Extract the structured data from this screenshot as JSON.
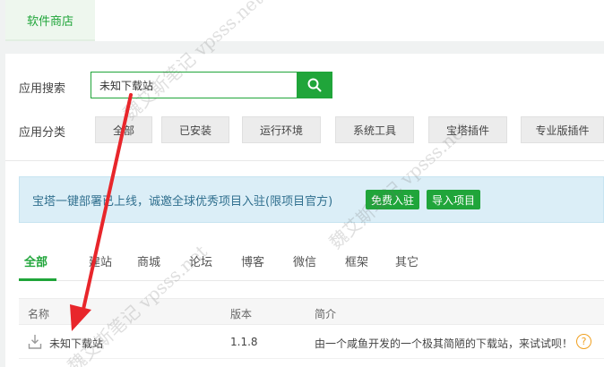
{
  "top_tab": {
    "label": "软件商店"
  },
  "search": {
    "label": "应用搜索",
    "value": "未知下载站"
  },
  "category": {
    "label": "应用分类",
    "buttons": [
      "全部",
      "已安装",
      "运行环境",
      "系统工具",
      "宝塔插件",
      "专业版插件"
    ]
  },
  "notice": {
    "text": "宝塔一键部署已上线，诚邀全球优秀项目入驻(限项目官方)",
    "btn_free": "免费入驻",
    "btn_import": "导入项目"
  },
  "tabs": [
    "全部",
    "建站",
    "商城",
    "论坛",
    "博客",
    "微信",
    "框架",
    "其它"
  ],
  "table": {
    "headers": [
      "名称",
      "版本",
      "简介"
    ],
    "rows": [
      {
        "name": "未知下载站",
        "version": "1.1.8",
        "desc": "由一个咸鱼开发的一个极其简陋的下载站，来试试呗！"
      }
    ]
  },
  "watermark": "魏艾斯笔记 vpsss.net",
  "colors": {
    "accent": "#20a53a",
    "notice_bg": "#dbeef7",
    "arrow": "#e8262b"
  }
}
